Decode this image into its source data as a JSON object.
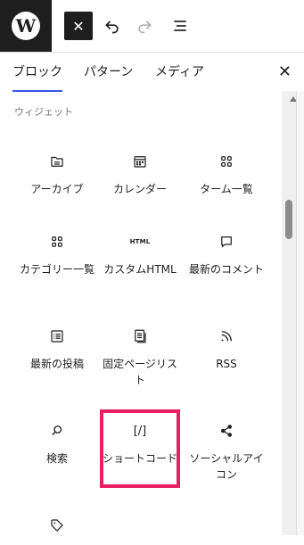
{
  "tabs": {
    "blocks": "ブロック",
    "patterns": "パターン",
    "media": "メディア"
  },
  "category_title": "ウィジェット",
  "html_icon_label": "HTML",
  "shortcode_icon_label": "[/]",
  "blocks": [
    {
      "label": "アーカイブ",
      "icon": "archive-icon"
    },
    {
      "label": "カレンダー",
      "icon": "calendar-icon"
    },
    {
      "label": "ターム一覧",
      "icon": "terms-grid-icon"
    },
    {
      "label": "カテゴリー一覧",
      "icon": "categories-grid-icon"
    },
    {
      "label": "カスタムHTML",
      "icon": "html-icon"
    },
    {
      "label": "最新のコメント",
      "icon": "comment-icon"
    },
    {
      "label": "最新の投稿",
      "icon": "latest-posts-icon"
    },
    {
      "label": "固定ページリスト",
      "icon": "page-list-icon"
    },
    {
      "label": "RSS",
      "icon": "rss-icon"
    },
    {
      "label": "検索",
      "icon": "search-icon"
    },
    {
      "label": "ショートコード",
      "icon": "shortcode-icon"
    },
    {
      "label": "ソーシャルアイコン",
      "icon": "share-icon"
    },
    {
      "label": "",
      "icon": "tag-icon"
    }
  ],
  "highlight_color": "#e91e63",
  "accent_color": "#3858e9"
}
